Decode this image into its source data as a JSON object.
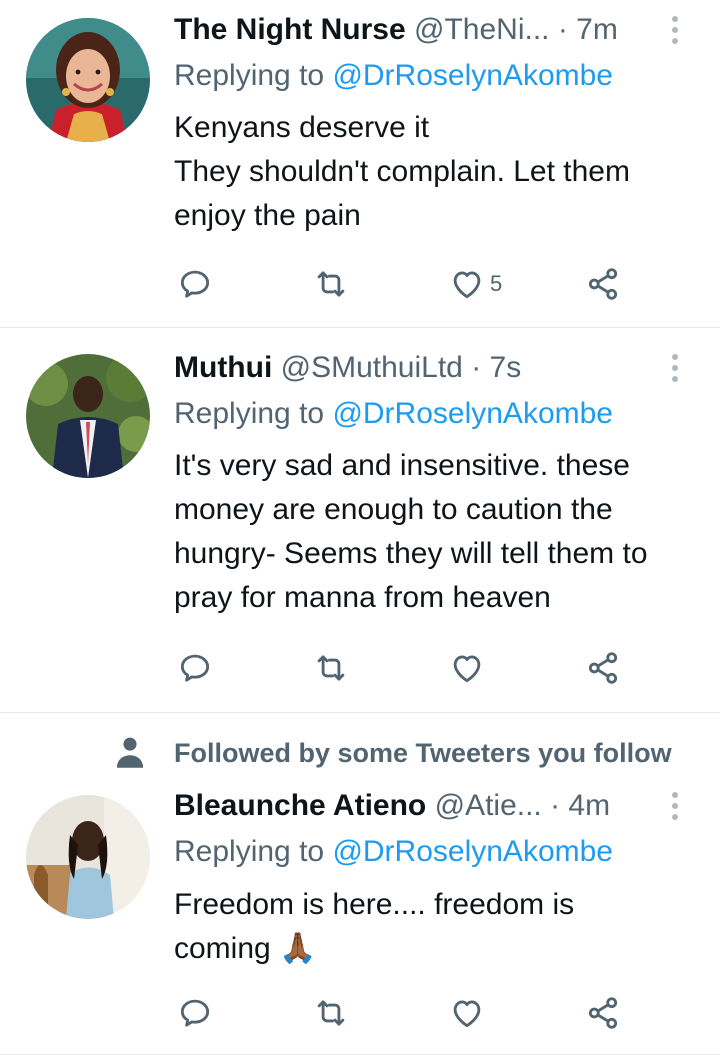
{
  "tweets": [
    {
      "name": "The Night Nurse",
      "handle": "@TheNi...",
      "time": "· 7m",
      "replying_label": "Replying to",
      "replying_to": "@DrRoselynAkombe",
      "lines": [
        "Kenyans deserve it",
        "They shouldn't complain. Let them enjoy the pain"
      ],
      "like_count": "5"
    },
    {
      "name": "Muthui",
      "handle": "@SMuthuiLtd",
      "time": "· 7s",
      "replying_label": "Replying to",
      "replying_to": "@DrRoselynAkombe",
      "lines": [
        "It's very sad and insensitive. these money are enough to caution the hungry- Seems they will tell them to pray for manna from heaven"
      ],
      "like_count": ""
    },
    {
      "social_context": "Followed by some Tweeters you follow",
      "name": "Bleaunche Atieno",
      "handle": "@Atie...",
      "time": "· 4m",
      "replying_label": "Replying to",
      "replying_to": "@DrRoselynAkombe",
      "lines": [
        "Freedom is here.... freedom is coming 🙏🏾"
      ],
      "like_count": ""
    }
  ],
  "icons": {
    "reply": "reply-icon",
    "retweet": "retweet-icon",
    "like": "heart-icon",
    "share": "share-icon",
    "more": "more-vertical-icon",
    "social": "person-icon"
  },
  "colors": {
    "text": "#0f1419",
    "secondary": "#536471",
    "link": "#1d9bf0",
    "divider": "#e6e9ec"
  }
}
